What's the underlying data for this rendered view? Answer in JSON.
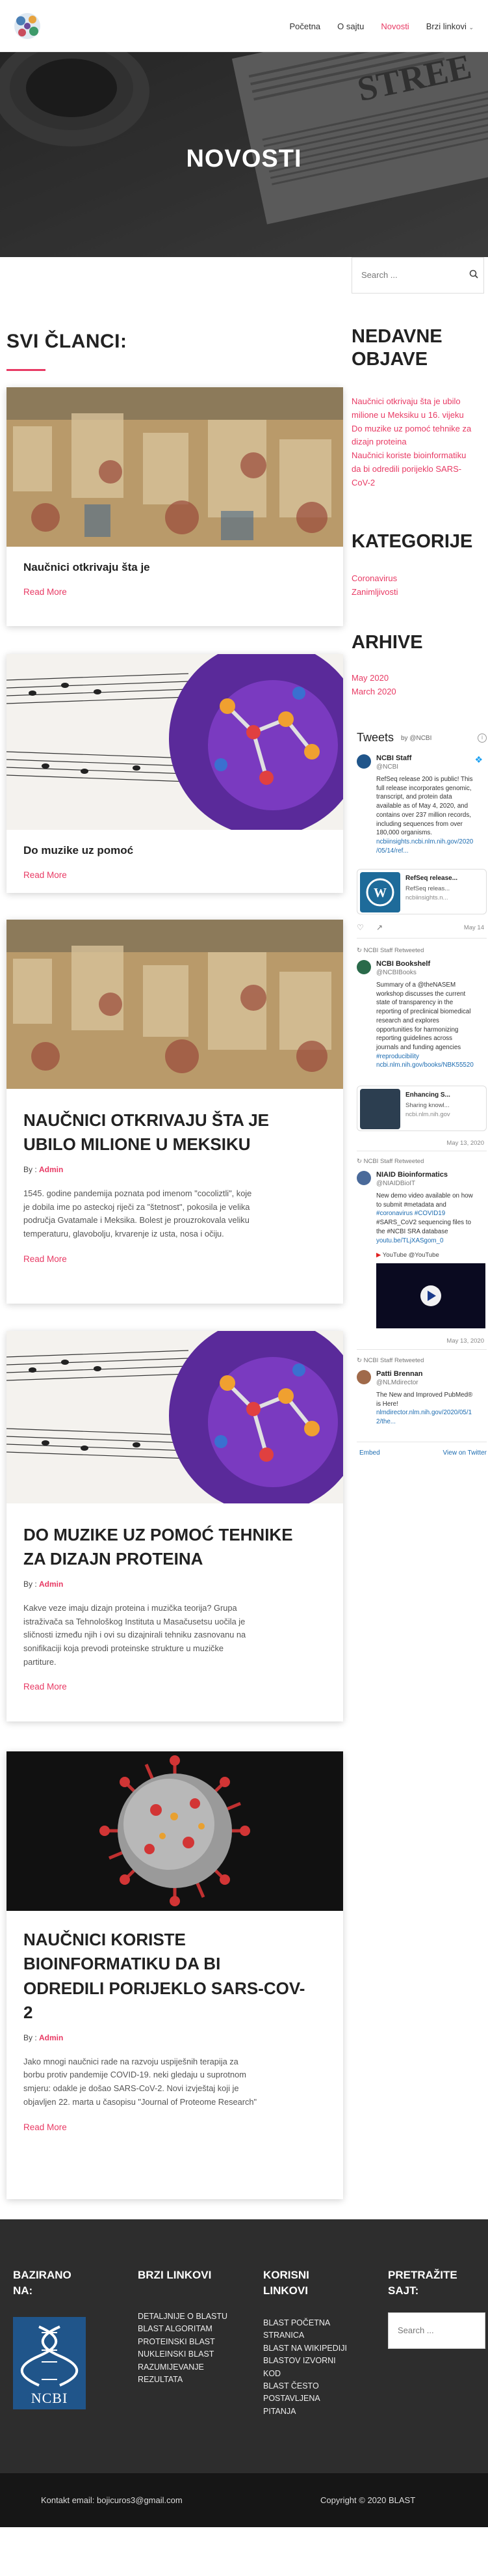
{
  "nav": {
    "items": [
      "Početna",
      "O sajtu",
      "Novosti",
      "Brzi linkovi"
    ],
    "active": "Novosti"
  },
  "hero": {
    "title": "NOVOSTI"
  },
  "main": {
    "section_title": "SVI ČLANCI:",
    "small_cards": [
      {
        "title": "Naučnici otkrivaju šta je",
        "readmore": "Read More"
      },
      {
        "title": "Do muzike uz pomoć",
        "readmore": "Read More"
      }
    ],
    "posts": [
      {
        "title_lines": [
          "NAUČNICI OTKRIVAJU ŠTA JE",
          "UBILO MILIONE U MEKSIKU"
        ],
        "by": "By :",
        "author": "Admin",
        "excerpt_lines": [
          "1545. godine pandemija poznata pod imenom \"cocoliztli\", koje",
          "je dobila ime po asteckoj riječi za \"štetnost\", pokosila je velika",
          "područja Gvatamale i Meksika. Bolest je prouzrokovala veliku",
          "temperaturu, glavobolju, krvarenje iz usta, nosa i očiju."
        ],
        "readmore": "Read More"
      },
      {
        "title_lines": [
          "DO MUZIKE UZ POMOĆ TEHNIKE",
          "ZA DIZAJN PROTEINA"
        ],
        "by": "By :",
        "author": "Admin",
        "excerpt_lines": [
          "Kakve veze imaju dizajn proteina i muzička teorija? Grupa",
          "istraživača sa Tehnološkog Instituta u Masačusetsu uočila je",
          "sličnosti između njih i ovi su dizajnirali tehniku zasnovanu na",
          "sonifikaciji koja prevodi proteinske strukture u muzičke",
          "partiture."
        ],
        "readmore": "Read More"
      },
      {
        "title_lines": [
          "NAUČNICI KORISTE",
          "BIOINFORMATIKU DA BI",
          "ODREDILI PORIJEKLO SARS-COV-",
          "2"
        ],
        "by": "By :",
        "author": "Admin",
        "excerpt_lines": [
          "Jako mnogi naučnici rade na razvoju uspiješnih terapija za",
          "borbu protiv pandemije COVID-19. neki gledaju u suprotnom",
          "smjeru: odakle je došao SARS-CoV-2. Novi izvještaj koji je",
          "objavljen 22. marta u časopisu \"Journal of Proteome Research\""
        ],
        "readmore": "Read More"
      }
    ]
  },
  "sidebar": {
    "search_placeholder": "Search ...",
    "recent_title_lines": [
      "NEDAVNE",
      "OBJAVE"
    ],
    "recent_lines": [
      "Naučnici otkrivaju šta je ubilo",
      "milione u Meksiku u 16. vijeku",
      "Do muzike uz pomoć tehnike za",
      "dizajn proteina",
      "Naučnici koriste bioinformatiku",
      "da bi odredili porijeklo SARS-",
      "CoV-2"
    ],
    "categories_title": "KATEGORIJE",
    "categories": [
      "Coronavirus",
      "Zanimljivosti"
    ],
    "archive_title": "ARHIVE",
    "archive": [
      "May 2020",
      "March 2020"
    ],
    "tweets": {
      "header": "Tweets",
      "by": "by @NCBI",
      "t1_name": "NCBI Staff",
      "t1_handle": "@NCBI",
      "t1_lines": [
        "RefSeq release 200 is public! This",
        "full release incorporates genomic,",
        "transcript, and protein data",
        "available as of May 4, 2020, and",
        "contains over 237 million records,",
        "including sequences from over",
        "180,000 organisms.",
        "ncbiinsights.ncbi.nlm.nih.gov/2020",
        "/05/14/ref..."
      ],
      "card1_title": "RefSeq release...",
      "card1_l1": "RefSeq releas...",
      "card1_l2": "ncbiinsights.n...",
      "rt1": "NCBI Staff Retweeted",
      "t2_name": "NCBI Bookshelf",
      "t2_handle": "@NCBIBooks",
      "t2_lines": [
        "Summary of a @theNASEM",
        "workshop discusses the current",
        "state of transparency in the",
        "reporting of preclinical biomedical",
        "research and explores",
        "opportunities for harmonizing",
        "reporting guidelines across",
        "journals and funding agencies",
        "#reproducibility",
        "ncbi.nlm.nih.gov/books/NBK55520"
      ],
      "card2_l1": "Enhancing S...",
      "card2_l2": "Sharing knowl...",
      "card2_l3": "ncbi.nlm.nih.gov",
      "date1": "May 13, 2020",
      "rt2": "NCBI Staff Retweeted",
      "t3_name": "NIAID Bioinformatics",
      "t3_handle": "@NIAIDBioIT",
      "t3_lines": [
        "New demo video available on how",
        "to submit #metadata and",
        "#coronavirus #COVID19",
        "#SARS_CoV2 sequencing files to",
        "the #NCBI SRA database",
        "youtu.be/TLjXASgom_0"
      ],
      "yt_label": "YouTube @YouTube",
      "date2": "May 13, 2020",
      "rt3": "NCBI Staff Retweeted",
      "t4_name": "Patti Brennan",
      "t4_handle": "@NLMdirector",
      "t4_lines": [
        "The New and Improved PubMed®",
        "is Here!",
        "nlmdirector.nlm.nih.gov/2020/05/1",
        "2/the..."
      ],
      "embed": "Embed",
      "view": "View on Twitter"
    }
  },
  "footer": {
    "col1_title_lines": [
      "BAZIRANO",
      "NA:"
    ],
    "ncbi_logo_text": "NCBI",
    "col2_title": "BRZI LINKOVI",
    "col2_links": [
      "DETALJNIJE O BLASTU",
      "BLAST ALGORITAM",
      "PROTEINSKI BLAST",
      "NUKLEINSKI BLAST",
      "RAZUMIJEVANJE",
      "REZULTATA"
    ],
    "col3_title_lines": [
      "KORISNI",
      "LINKOVI"
    ],
    "col3_links": [
      "BLAST POČETNA",
      "STRANICA",
      "BLAST NA WIKIPEDIJI",
      "BLASTOV IZVORNI",
      "KOD",
      "BLAST ČESTO",
      "POSTAVLJENA",
      "PITANJA"
    ],
    "col4_title_lines": [
      "PRETRAŽITE",
      "SAJT:"
    ],
    "col4_placeholder": "Search ...",
    "contact": "Kontakt email: bojicuros3@gmail.com",
    "copyright": "Copyright © 2020 BLAST"
  },
  "colors": {
    "accent": "#e83a64",
    "footer_bg": "#2d2d2d",
    "copy_bg": "#161616"
  }
}
